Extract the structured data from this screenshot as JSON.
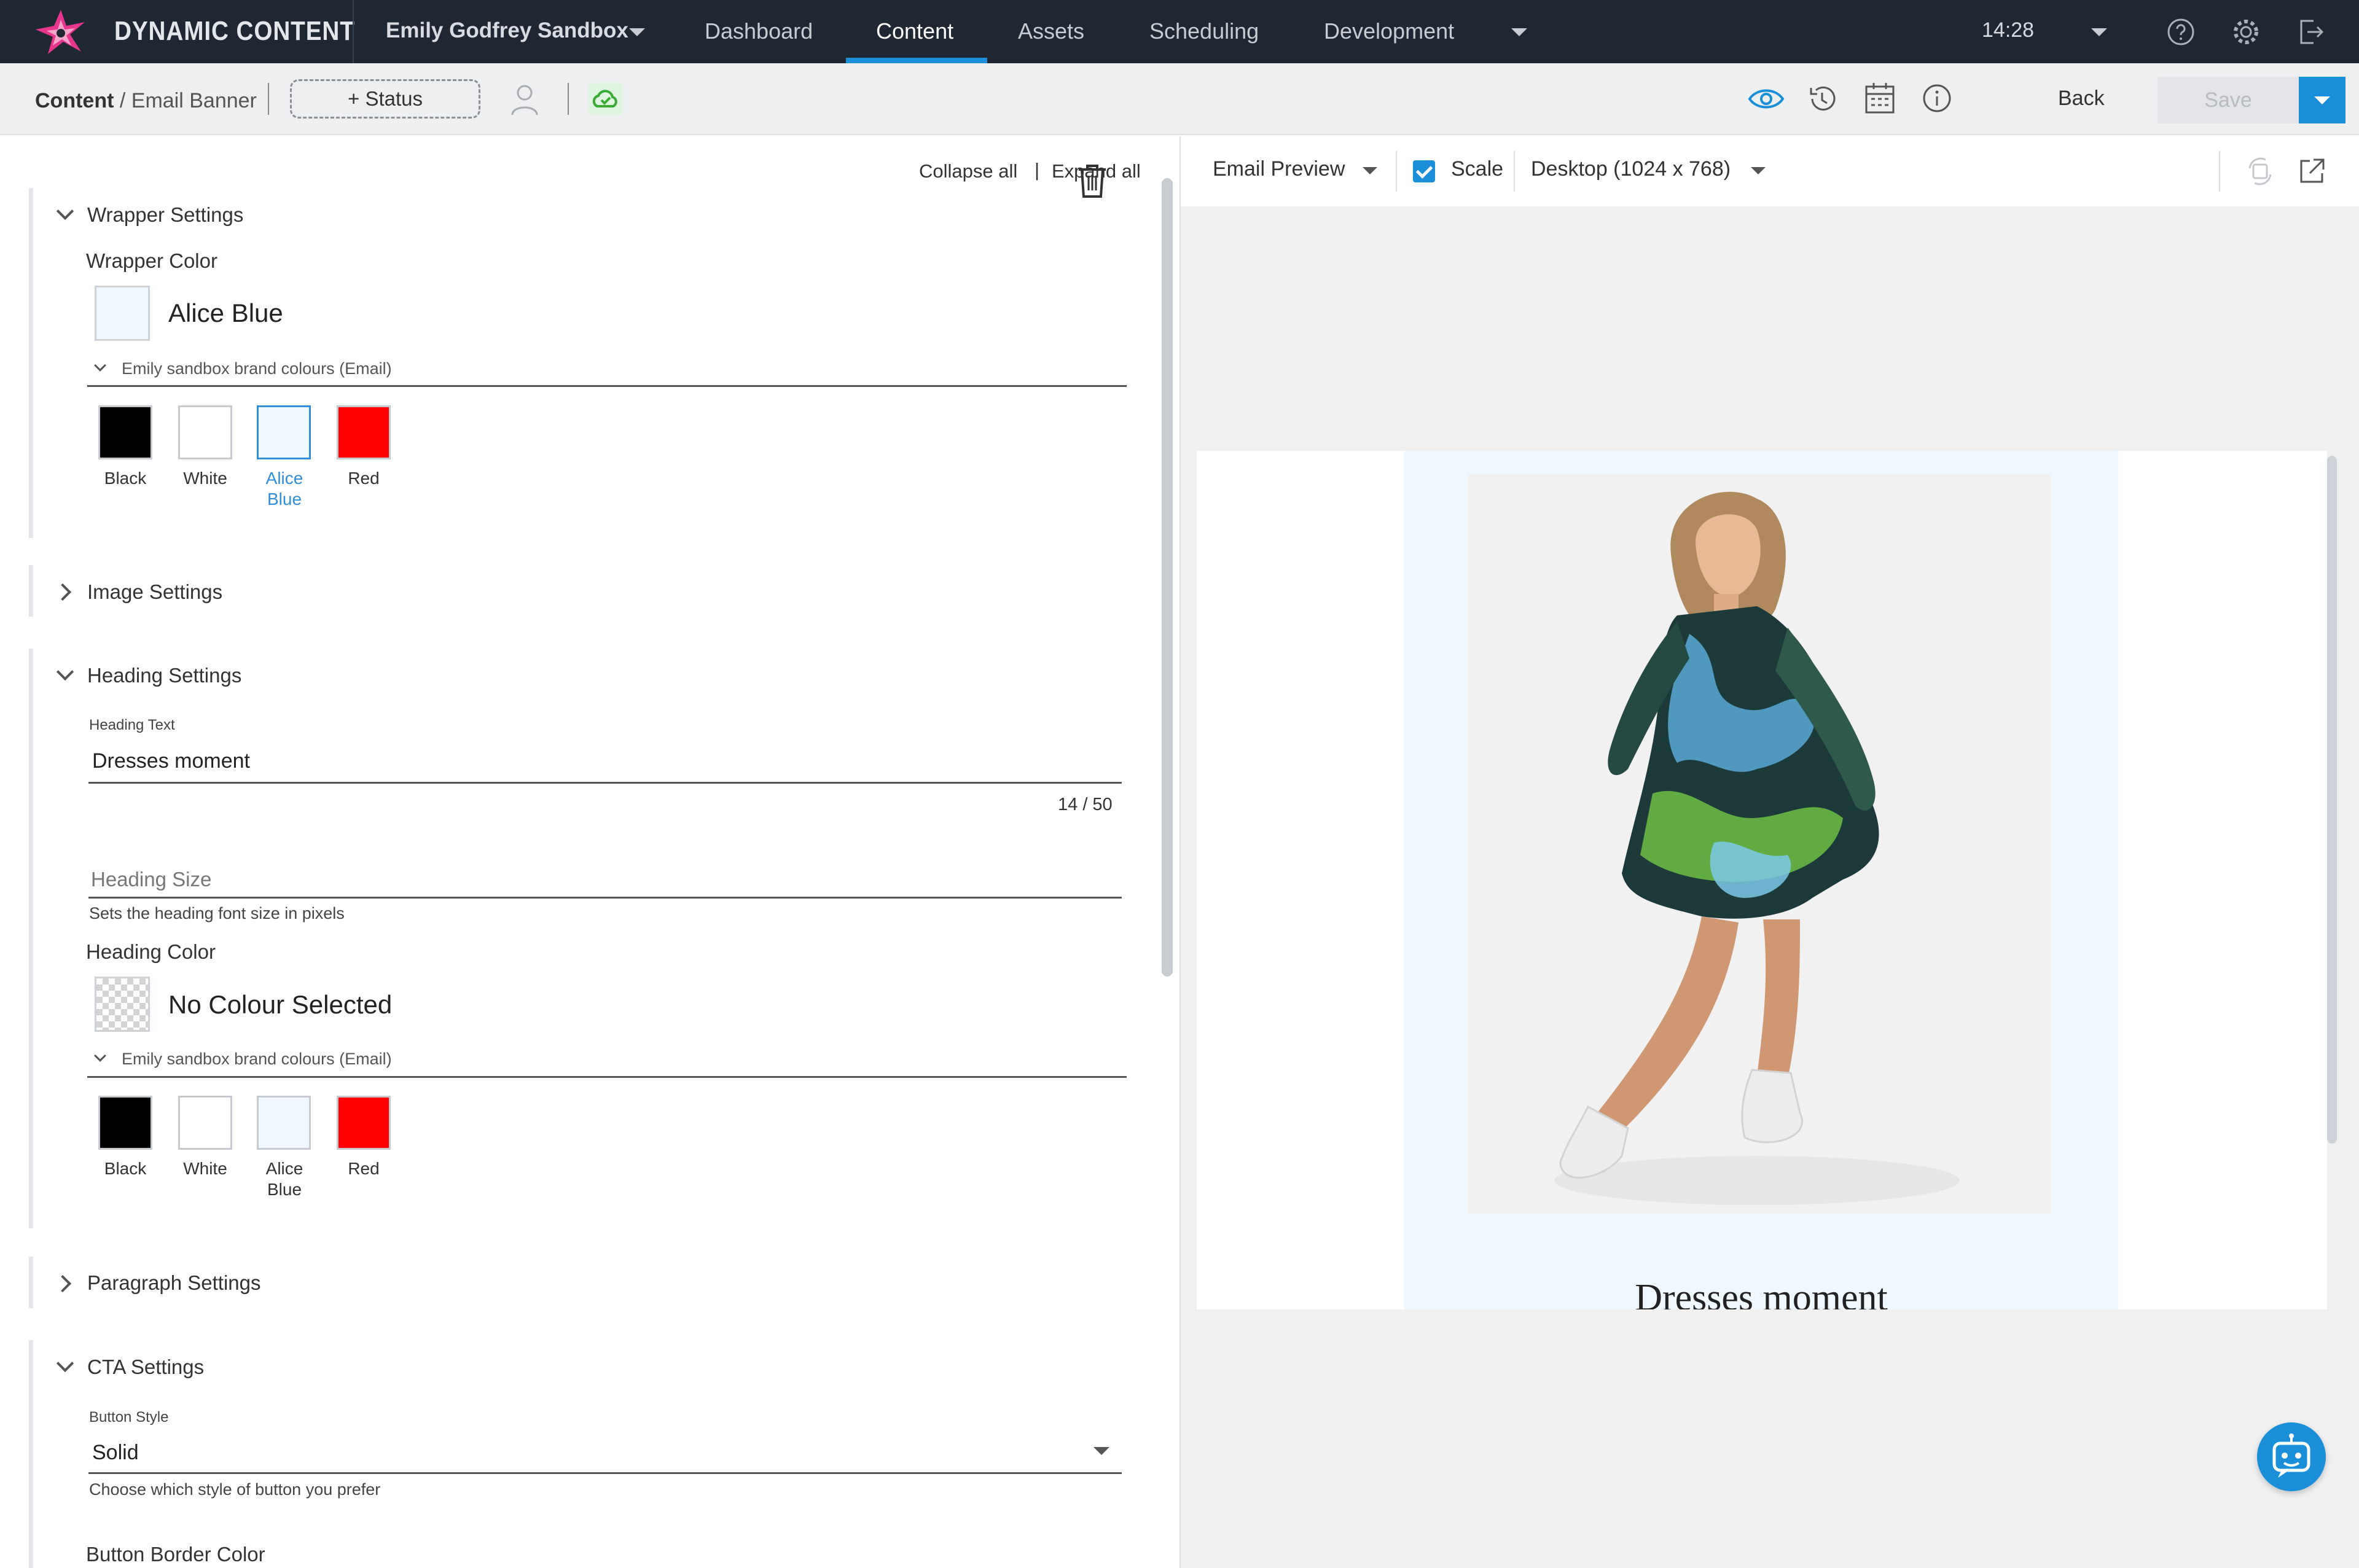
{
  "topnav": {
    "brand": "DYNAMIC CONTENT",
    "hub": "Emily Godfrey Sandbox",
    "items": [
      "Dashboard",
      "Content",
      "Assets",
      "Scheduling",
      "Development"
    ],
    "active": "Content",
    "time": "14:28",
    "icons": [
      "help-icon",
      "gear-icon",
      "logout-icon"
    ]
  },
  "toolbar": {
    "breadcrumb_root": "Content",
    "breadcrumb_current": "/ Email Banner",
    "status_label": "+ Status",
    "back_label": "Back",
    "save_label": "Save"
  },
  "editor": {
    "collapse_all": "Collapse all",
    "divider": "|",
    "expand_all": "Expand all",
    "wrapper": {
      "title": "Wrapper Settings",
      "color_label": "Wrapper Color",
      "color_value": "Alice Blue",
      "color_hex": "#f0f8ff",
      "palette_label": "Emily sandbox brand colours (Email)",
      "swatches": [
        {
          "name": "Black",
          "hex": "#000000"
        },
        {
          "name": "White",
          "hex": "#ffffff"
        },
        {
          "name1": "Alice",
          "name2": "Blue",
          "hex": "#f0f8ff",
          "selected": true
        },
        {
          "name": "Red",
          "hex": "#ff0000"
        }
      ]
    },
    "image": {
      "title": "Image Settings"
    },
    "heading": {
      "title": "Heading Settings",
      "text_label": "Heading Text",
      "text_value": "Dresses moment",
      "counter": "14 / 50",
      "size_placeholder": "Heading Size",
      "size_helper": "Sets the heading font size in pixels",
      "color_label": "Heading Color",
      "color_value": "No Colour Selected",
      "palette_label": "Emily sandbox brand colours (Email)",
      "swatches": [
        {
          "name": "Black",
          "hex": "#000000"
        },
        {
          "name": "White",
          "hex": "#ffffff"
        },
        {
          "name1": "Alice",
          "name2": "Blue",
          "hex": "#f0f8ff"
        },
        {
          "name": "Red",
          "hex": "#ff0000"
        }
      ]
    },
    "paragraph": {
      "title": "Paragraph Settings"
    },
    "cta": {
      "title": "CTA Settings",
      "style_label": "Button Style",
      "style_value": "Solid",
      "style_helper": "Choose which style of button you prefer",
      "border_color_label": "Button Border Color"
    }
  },
  "preview": {
    "mode": "Email Preview",
    "scale_label": "Scale",
    "scale_checked": true,
    "device": "Desktop (1024 x 768)",
    "email_heading": "Dresses moment",
    "accent": "#1a8fd9"
  }
}
